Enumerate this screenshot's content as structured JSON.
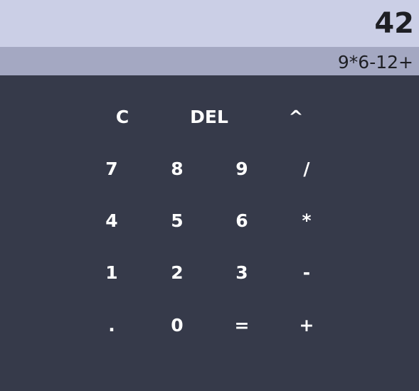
{
  "display": {
    "result": "42",
    "expression": "9*6-12+"
  },
  "keypad": {
    "clear": "C",
    "delete": "DEL",
    "power": "^",
    "seven": "7",
    "eight": "8",
    "nine": "9",
    "divide": "/",
    "four": "4",
    "five": "5",
    "six": "6",
    "multiply": "*",
    "one": "1",
    "two": "2",
    "three": "3",
    "minus": "-",
    "decimal": ".",
    "zero": "0",
    "equals": "=",
    "plus": "+"
  }
}
